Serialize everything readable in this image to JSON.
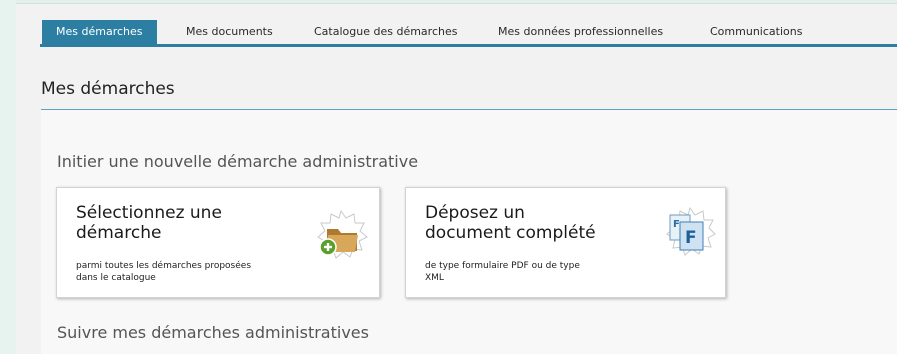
{
  "nav": {
    "tabs": [
      {
        "label": "Mes démarches",
        "active": true
      },
      {
        "label": "Mes documents",
        "active": false
      },
      {
        "label": "Catalogue des démarches",
        "active": false
      },
      {
        "label": "Mes données professionnelles",
        "active": false
      },
      {
        "label": "Communications",
        "active": false
      }
    ]
  },
  "page": {
    "title": "Mes démarches"
  },
  "initiate": {
    "heading": "Initier une nouvelle démarche administrative",
    "cards": [
      {
        "title_line1": "Sélectionnez une",
        "title_line2": "démarche",
        "desc_line1": "parmi toutes les démarches proposées",
        "desc_line2": "dans le catalogue",
        "icon": "folder-add-icon"
      },
      {
        "title_line1": "Déposez un",
        "title_line2": "document complété",
        "desc_line1": "de type formulaire PDF ou de type",
        "desc_line2": "XML",
        "icon": "form-document-icon"
      }
    ]
  },
  "follow": {
    "heading": "Suivre mes démarches administratives"
  },
  "colors": {
    "accent": "#2c7fa3",
    "background": "#f2f2f2",
    "outer": "#e6f3ef"
  }
}
